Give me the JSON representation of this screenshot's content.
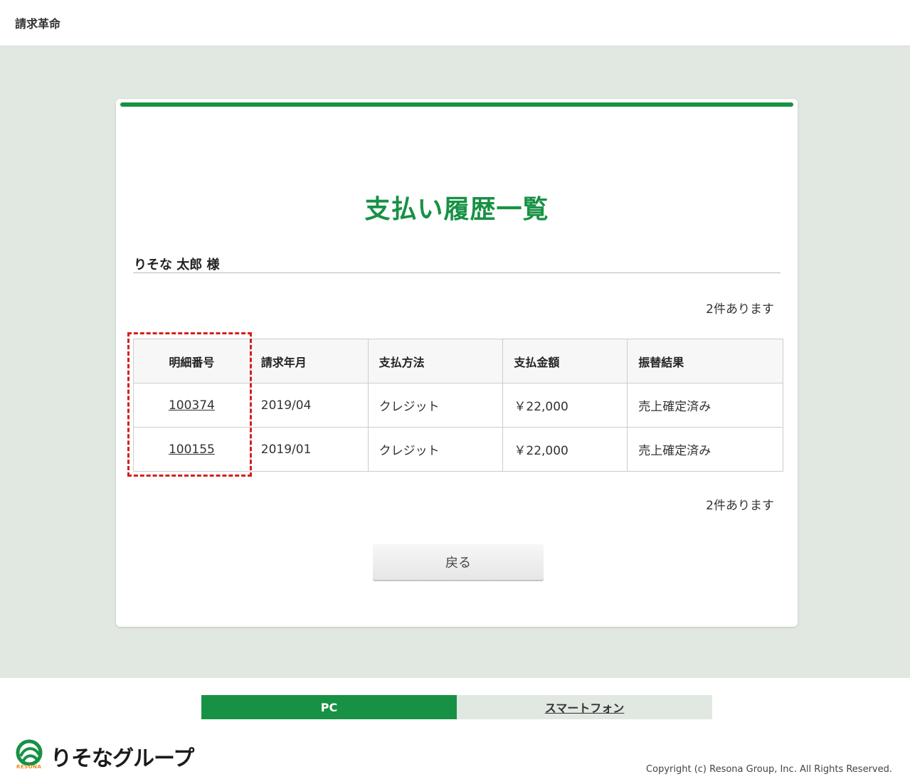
{
  "header": {
    "app_title": "請求革命"
  },
  "page": {
    "title": "支払い履歴一覧",
    "customer_name": "りそな 太郎 様",
    "count_top": "2件あります",
    "count_bottom": "2件あります",
    "back_label": "戻る"
  },
  "table": {
    "headers": [
      "明細番号",
      "請求年月",
      "支払方法",
      "支払金額",
      "振替結果"
    ],
    "rows": [
      [
        "100374",
        "2019/04",
        "クレジット",
        "￥22,000",
        "売上確定済み"
      ],
      [
        "100155",
        "2019/01",
        "クレジット",
        "￥22,000",
        "売上確定済み"
      ]
    ]
  },
  "footer": {
    "pc_label": "PC",
    "smartphone_label": "スマートフォン",
    "logo_text": "りそなグループ",
    "logo_sub": "RESONA",
    "copyright": "Copyright (c) Resona Group, Inc. All Rights Reserved."
  },
  "colors": {
    "accent": "#179144",
    "background": "#e1e8e1",
    "highlight": "#d4201b"
  }
}
